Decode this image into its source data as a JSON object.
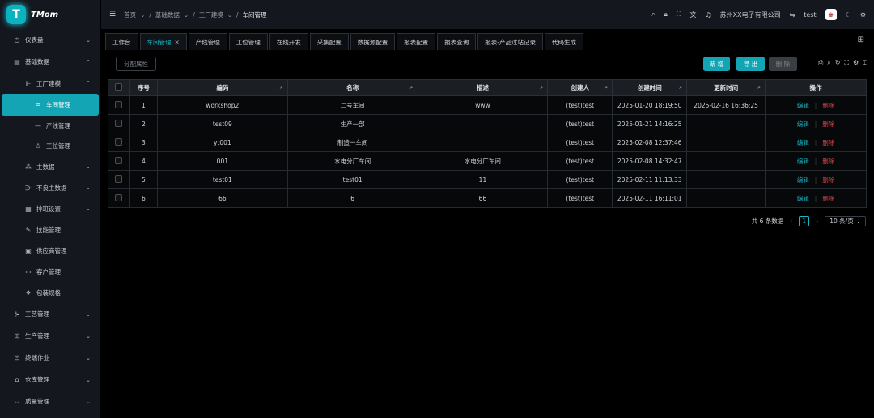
{
  "logo": {
    "mark": "T",
    "text": "TMom"
  },
  "breadcrumb": [
    "首页",
    "基础数据",
    "工厂建模",
    "车间管理"
  ],
  "topbar": {
    "company": "苏州XX电子有限公司",
    "user": "test"
  },
  "sidebar": {
    "dashboard": "仪表盘",
    "basic_data": "基础数据",
    "factory_model": "工厂建模",
    "workshop": "车间管理",
    "line": "产线管理",
    "station": "工位管理",
    "master": "主数据",
    "defect": "不良主数据",
    "schedule": "排班设置",
    "skill": "技能管理",
    "supplier": "供应商管理",
    "customer": "客户管理",
    "package": "包装规格",
    "process": "工艺管理",
    "production": "生产管理",
    "terminal": "终端作业",
    "warehouse": "仓库管理",
    "quality": "质量管理"
  },
  "tabs": [
    "工作台",
    "车间管理",
    "产线管理",
    "工位管理",
    "在线开发",
    "采集配置",
    "数据源配置",
    "报表配置",
    "报表查询",
    "报表-产品过站记录",
    "代码生成"
  ],
  "toolbar": {
    "assign_attr": "分配属性",
    "new": "新 增",
    "export": "导 出",
    "delete": "删 除"
  },
  "table": {
    "headers": [
      "序号",
      "编码",
      "名称",
      "描述",
      "创建人",
      "创建时间",
      "更新时间",
      "操作"
    ],
    "edit_label": "编辑",
    "delete_label": "删除",
    "rows": [
      [
        "1",
        "workshop2",
        "二号车间",
        "www",
        "(test)test",
        "2025-01-20 18:19:50",
        "2025-02-16 16:36:25"
      ],
      [
        "2",
        "test09",
        "生产一部",
        "",
        "(test)test",
        "2025-01-21 14:16:25",
        ""
      ],
      [
        "3",
        "yt001",
        "制造一车间",
        "",
        "(test)test",
        "2025-02-08 12:37:46",
        ""
      ],
      [
        "4",
        "001",
        "水电分厂车间",
        "水电分厂车间",
        "(test)test",
        "2025-02-08 14:32:47",
        ""
      ],
      [
        "5",
        "test01",
        "test01",
        "11",
        "(test)test",
        "2025-02-11 11:13:33",
        ""
      ],
      [
        "6",
        "66",
        "6",
        "66",
        "(test)test",
        "2025-02-11 16:11:01",
        ""
      ]
    ]
  },
  "pagination": {
    "total": "共 6 条数据",
    "current": "1",
    "page_size": "10 条/页"
  }
}
